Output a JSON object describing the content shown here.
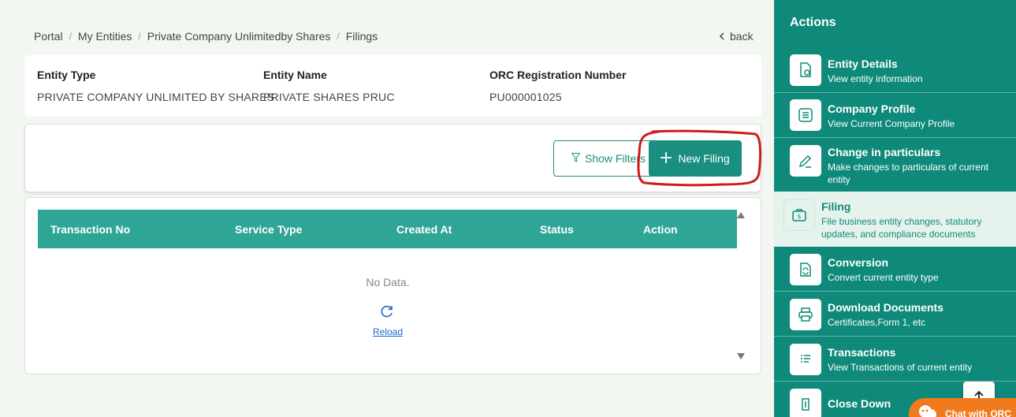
{
  "breadcrumb": {
    "items": [
      "Portal",
      "My Entities",
      "Private Company Unlimitedby Shares",
      "Filings"
    ],
    "separator": "/",
    "back_label": "back"
  },
  "entity": {
    "type_label": "Entity Type",
    "type_value": "PRIVATE COMPANY UNLIMITED BY SHARES",
    "name_label": "Entity Name",
    "name_value": "PRIVATE SHARES PRUC",
    "reg_label": "ORC Registration Number",
    "reg_value": "PU000001025"
  },
  "toolbar": {
    "show_filters_label": "Show Filters",
    "new_filing_label": "New Filing"
  },
  "table": {
    "columns": [
      "Transaction No",
      "Service Type",
      "Created At",
      "Status",
      "Action"
    ],
    "empty_text": "No Data.",
    "reload_label": "Reload"
  },
  "sidebar": {
    "title": "Actions",
    "items": [
      {
        "title": "Entity Details",
        "desc": "View entity information",
        "icon": "document-search-icon"
      },
      {
        "title": "Company Profile",
        "desc": "View Current Company Profile",
        "icon": "list-icon"
      },
      {
        "title": "Change in particulars",
        "desc": "Make changes to particulars of current entity",
        "icon": "pencil-icon"
      },
      {
        "title": "Filing",
        "desc": "File business entity changes, statutory updates, and compliance documents",
        "icon": "briefcase-dollar-icon"
      },
      {
        "title": "Conversion",
        "desc": "Convert current entity type",
        "icon": "convert-document-icon"
      },
      {
        "title": "Download Documents",
        "desc": "Certificates,Form 1, etc",
        "icon": "printer-icon"
      },
      {
        "title": "Transactions",
        "desc": "View Transactions of current entity",
        "icon": "transactions-list-icon"
      },
      {
        "title": "Close Down",
        "desc": "",
        "icon": "close-down-icon"
      }
    ]
  },
  "chat": {
    "label": "Chat with ORC"
  },
  "colors": {
    "accent": "#0f8a7a",
    "header": "#2fa596",
    "annotation": "#d01a1a",
    "chat": "#f07a1c"
  }
}
